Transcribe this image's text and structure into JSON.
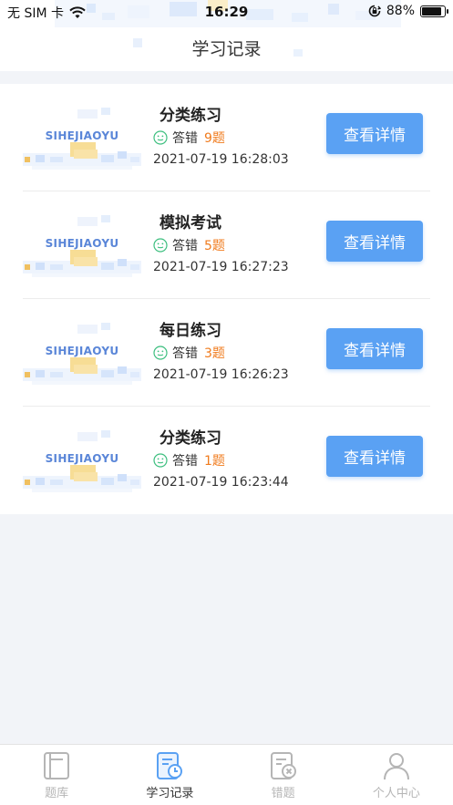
{
  "status_bar": {
    "carrier": "无 SIM 卡",
    "time": "16:29",
    "battery_text": "88%",
    "battery_level": 0.88,
    "icons": [
      "wifi-icon",
      "orientation-lock-icon",
      "battery-icon"
    ]
  },
  "header": {
    "title": "学习记录"
  },
  "records": [
    {
      "title": "分类练习",
      "wrong_label": "答错",
      "wrong_count": "9题",
      "time": "2021-07-19 16:28:03",
      "button": "查看详情",
      "logo_text": "SIHEJIAOYU"
    },
    {
      "title": "模拟考试",
      "wrong_label": "答错",
      "wrong_count": "5题",
      "time": "2021-07-19 16:27:23",
      "button": "查看详情",
      "logo_text": "SIHEJIAOYU"
    },
    {
      "title": "每日练习",
      "wrong_label": "答错",
      "wrong_count": "3题",
      "time": "2021-07-19 16:26:23",
      "button": "查看详情",
      "logo_text": "SIHEJIAOYU"
    },
    {
      "title": "分类练习",
      "wrong_label": "答错",
      "wrong_count": "1题",
      "time": "2021-07-19 16:23:44",
      "button": "查看详情",
      "logo_text": "SIHEJIAOYU"
    }
  ],
  "tabbar": {
    "tabs": [
      {
        "label": "题库",
        "icon": "question-bank-icon",
        "active": false
      },
      {
        "label": "学习记录",
        "icon": "study-record-icon",
        "active": true
      },
      {
        "label": "错题",
        "icon": "wrong-questions-icon",
        "active": false
      },
      {
        "label": "个人中心",
        "icon": "profile-icon",
        "active": false
      }
    ]
  },
  "colors": {
    "accent": "#5aa1f3",
    "wrong_count": "#f07b1d",
    "smiley": "#3dbf7f",
    "tab_inactive": "#b5b5b5"
  }
}
